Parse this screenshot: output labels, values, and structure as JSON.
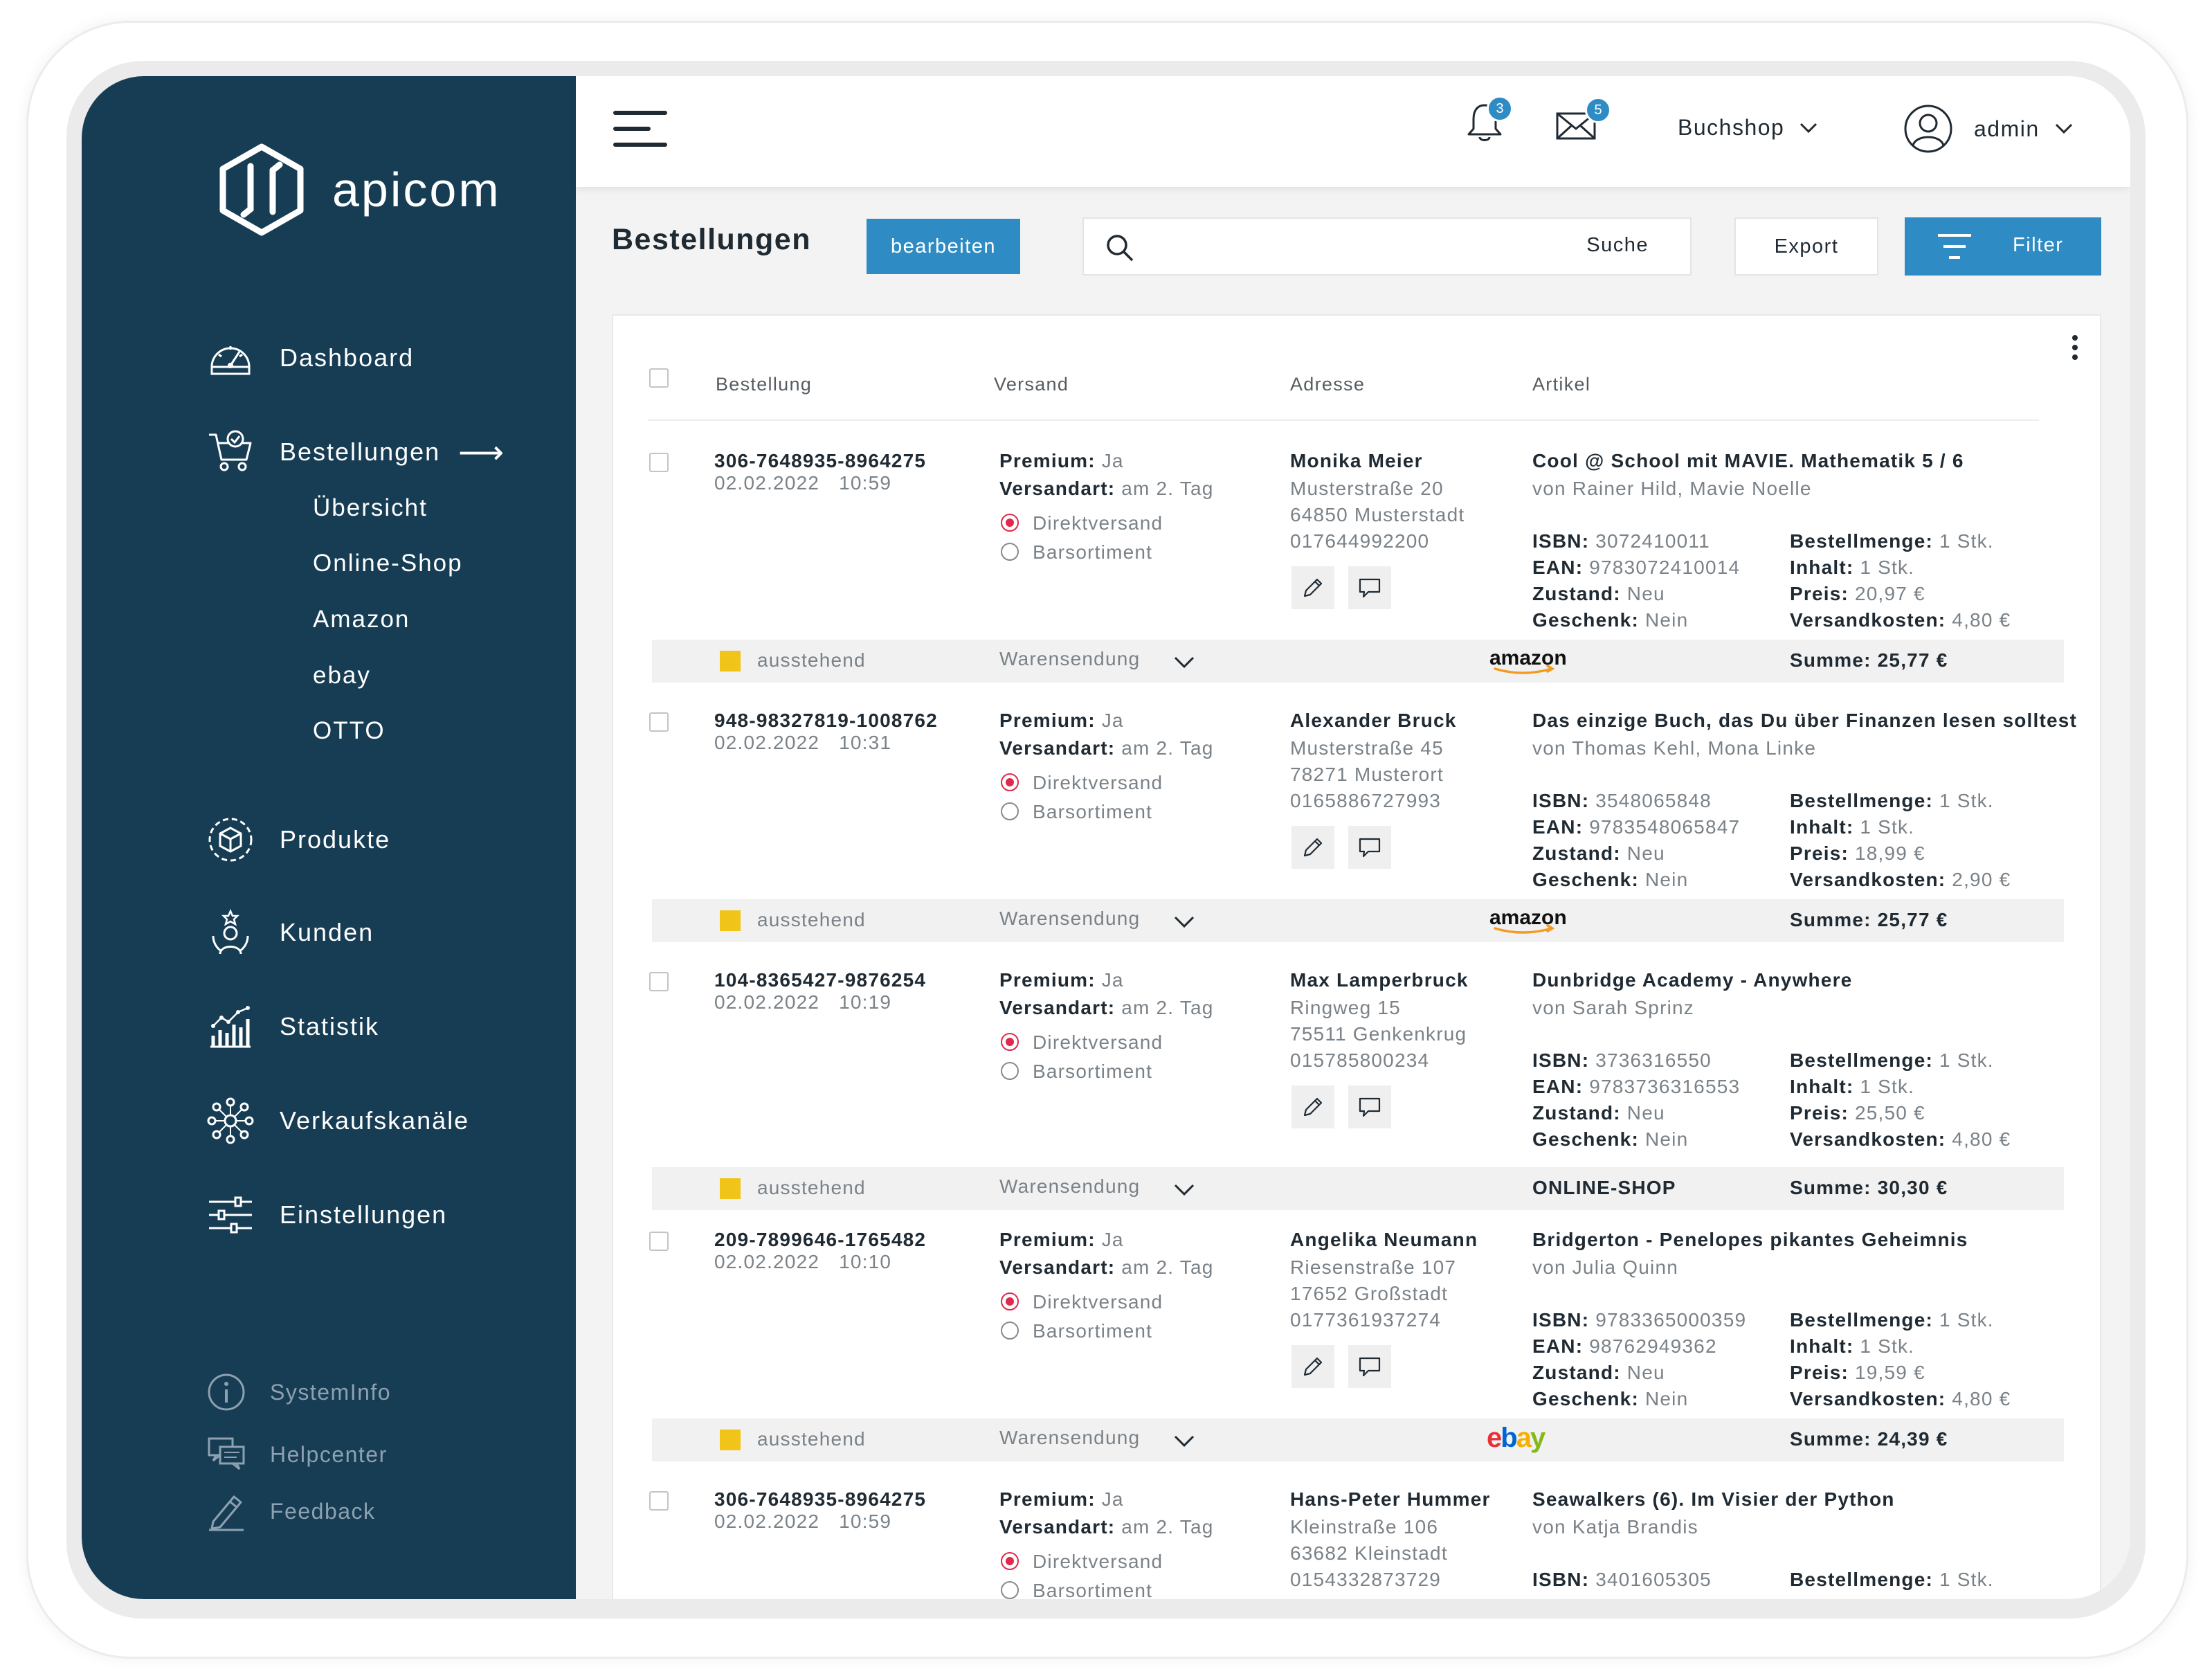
{
  "brand": {
    "name": "apicom"
  },
  "sidebar": {
    "items": [
      {
        "label": "Dashboard",
        "icon": "speedometer-icon"
      },
      {
        "label": "Bestellungen",
        "icon": "cart-icon"
      },
      {
        "label": "Produkte",
        "icon": "box-icon"
      },
      {
        "label": "Kunden",
        "icon": "customer-icon"
      },
      {
        "label": "Statistik",
        "icon": "chart-icon"
      },
      {
        "label": "Verkaufskanäle",
        "icon": "network-icon"
      },
      {
        "label": "Einstellungen",
        "icon": "sliders-icon"
      }
    ],
    "subitems": [
      "Übersicht",
      "Online-Shop",
      "Amazon",
      "ebay",
      "OTTO"
    ],
    "footer": [
      {
        "label": "SystemInfo",
        "icon": "info-icon"
      },
      {
        "label": "Helpcenter",
        "icon": "chat-icon"
      },
      {
        "label": "Feedback",
        "icon": "pencil-icon"
      }
    ]
  },
  "topbar": {
    "notifications_count": "3",
    "messages_count": "5",
    "shop_selector": "Buchshop",
    "user": "admin"
  },
  "toolbar": {
    "title": "Bestellungen",
    "edit_label": "bearbeiten",
    "search_label": "Suche",
    "export_label": "Export",
    "filter_label": "Filter"
  },
  "table": {
    "columns": [
      "Bestellung",
      "Versand",
      "Adresse",
      "Artikel"
    ],
    "labels": {
      "premium": "Premium:",
      "shipping_type": "Versandart:",
      "direct": "Direktversand",
      "wholesale": "Barsortiment",
      "by": "von",
      "isbn": "ISBN:",
      "ean": "EAN:",
      "condition": "Zustand:",
      "gift": "Geschenk:",
      "qty": "Bestellmenge:",
      "content": "Inhalt:",
      "price": "Preis:",
      "shipping_cost": "Versandkosten:",
      "sum": "Summe:",
      "status": "ausstehend",
      "shipment": "Warensendung"
    },
    "orders": [
      {
        "id": "306-7648935-8964275",
        "date": "02.02.2022",
        "time": "10:59",
        "premium": "Ja",
        "shipping_type": "am 2. Tag",
        "name": "Monika Meier",
        "street": "Musterstraße 20",
        "city": "64850 Musterstadt",
        "phone": "017644992200",
        "title": "Cool @ School mit MAVIE. Mathematik 5 / 6",
        "authors": "von Rainer Hild, Mavie Noelle",
        "isbn": "3072410011",
        "ean": "9783072410014",
        "condition": "Neu",
        "gift": "Nein",
        "qty": "1 Stk.",
        "content": "1 Stk.",
        "price": "20,97 €",
        "shipping_cost": "4,80 €",
        "channel": "amazon",
        "sum": "Summe: 25,77 €"
      },
      {
        "id": "948-98327819-1008762",
        "date": "02.02.2022",
        "time": "10:31",
        "premium": "Ja",
        "shipping_type": "am 2. Tag",
        "name": "Alexander Bruck",
        "street": "Musterstraße 45",
        "city": "78271 Musterort",
        "phone": "0165886727993",
        "title": "Das einzige Buch, das Du über Finanzen lesen solltest",
        "authors": "von Thomas Kehl, Mona Linke",
        "isbn": "3548065848",
        "ean": "9783548065847",
        "condition": "Neu",
        "gift": "Nein",
        "qty": "1 Stk.",
        "content": "1 Stk.",
        "price": "18,99 €",
        "shipping_cost": "2,90 €",
        "channel": "amazon",
        "sum": "Summe: 25,77 €"
      },
      {
        "id": "104-8365427-9876254",
        "date": "02.02.2022",
        "time": "10:19",
        "premium": "Ja",
        "shipping_type": "am 2. Tag",
        "name": "Max Lamperbruck",
        "street": "Ringweg 15",
        "city": "75511 Genkenkrug",
        "phone": "015785800234",
        "title": "Dunbridge Academy - Anywhere",
        "authors": "von Sarah Sprinz",
        "isbn": "3736316550",
        "ean": "9783736316553",
        "condition": "Neu",
        "gift": "Nein",
        "qty": "1 Stk.",
        "content": "1 Stk.",
        "price": "25,50 €",
        "shipping_cost": "4,80 €",
        "channel": "ONLINE-SHOP",
        "sum": "Summe: 30,30 €"
      },
      {
        "id": "209-7899646-1765482",
        "date": "02.02.2022",
        "time": "10:10",
        "premium": "Ja",
        "shipping_type": "am 2. Tag",
        "name": "Angelika Neumann",
        "street": "Riesenstraße 107",
        "city": "17652 Großstadt",
        "phone": "0177361937274",
        "title": "Bridgerton - Penelopes pikantes Geheimnis",
        "authors": "von Julia Quinn",
        "isbn": "9783365000359",
        "ean": "98762949362",
        "condition": "Neu",
        "gift": "Nein",
        "qty": "1 Stk.",
        "content": "1 Stk.",
        "price": "19,59 €",
        "shipping_cost": "4,80 €",
        "channel": "ebay",
        "sum": "Summe: 24,39 €"
      },
      {
        "id": "306-7648935-8964275",
        "date": "02.02.2022",
        "time": "10:59",
        "premium": "Ja",
        "shipping_type": "am 2. Tag",
        "name": "Hans-Peter Hummer",
        "street": "Kleinstraße 106",
        "city": "63682 Kleinstadt",
        "phone": "0154332873729",
        "title": "Seawalkers (6). Im Visier der Python",
        "authors": "von Katja Brandis",
        "isbn": "3401605305",
        "qty": "1 Stk."
      }
    ]
  },
  "colors": {
    "sidebar": "#173d54",
    "accent": "#2e8bc4",
    "status_pending": "#f0c419",
    "radio_active": "#e0294b"
  }
}
